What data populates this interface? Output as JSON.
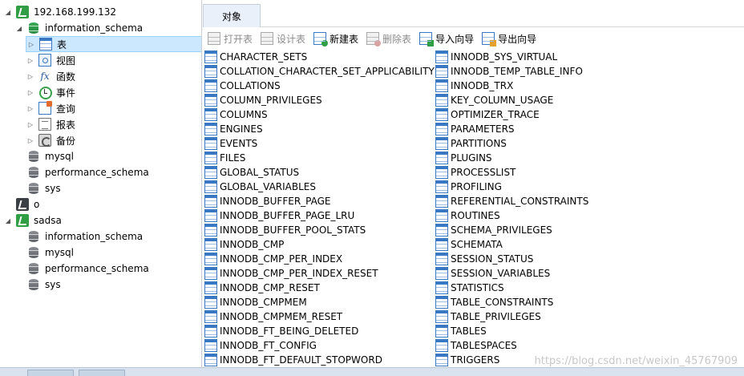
{
  "tree": {
    "connections": [
      {
        "name": "192.168.199.132",
        "icon": "mysql-connection-icon",
        "expanded": true,
        "databases": [
          {
            "name": "information_schema",
            "expanded": true,
            "children": [
              {
                "label": "表",
                "icon": "table-icon",
                "selected": true
              },
              {
                "label": "视图",
                "icon": "view-icon"
              },
              {
                "label": "函数",
                "icon": "function-icon"
              },
              {
                "label": "事件",
                "icon": "event-icon"
              },
              {
                "label": "查询",
                "icon": "query-icon"
              },
              {
                "label": "报表",
                "icon": "report-icon"
              },
              {
                "label": "备份",
                "icon": "backup-icon"
              }
            ]
          },
          {
            "name": "mysql"
          },
          {
            "name": "performance_schema"
          },
          {
            "name": "sys"
          }
        ]
      },
      {
        "name": "o",
        "icon": "mysql-connection-icon",
        "expanded": false,
        "databases": []
      },
      {
        "name": "sadsa",
        "icon": "mysql-connection-icon",
        "expanded": true,
        "databases": [
          {
            "name": "information_schema"
          },
          {
            "name": "mysql"
          },
          {
            "name": "performance_schema"
          },
          {
            "name": "sys"
          }
        ]
      }
    ]
  },
  "tabs": [
    {
      "label": "对象",
      "active": true
    }
  ],
  "toolbar": {
    "open_table": "打开表",
    "design_table": "设计表",
    "new_table": "新建表",
    "delete_table": "删除表",
    "import_wizard": "导入向导",
    "export_wizard": "导出向导"
  },
  "objects": {
    "column1": [
      "CHARACTER_SETS",
      "COLLATION_CHARACTER_SET_APPLICABILITY",
      "COLLATIONS",
      "COLUMN_PRIVILEGES",
      "COLUMNS",
      "ENGINES",
      "EVENTS",
      "FILES",
      "GLOBAL_STATUS",
      "GLOBAL_VARIABLES",
      "INNODB_BUFFER_PAGE",
      "INNODB_BUFFER_PAGE_LRU",
      "INNODB_BUFFER_POOL_STATS",
      "INNODB_CMP",
      "INNODB_CMP_PER_INDEX",
      "INNODB_CMP_PER_INDEX_RESET",
      "INNODB_CMP_RESET",
      "INNODB_CMPMEM",
      "INNODB_CMPMEM_RESET",
      "INNODB_FT_BEING_DELETED",
      "INNODB_FT_CONFIG",
      "INNODB_FT_DEFAULT_STOPWORD"
    ],
    "column2": [
      "INNODB_SYS_VIRTUAL",
      "INNODB_TEMP_TABLE_INFO",
      "INNODB_TRX",
      "KEY_COLUMN_USAGE",
      "OPTIMIZER_TRACE",
      "PARAMETERS",
      "PARTITIONS",
      "PLUGINS",
      "PROCESSLIST",
      "PROFILING",
      "REFERENTIAL_CONSTRAINTS",
      "ROUTINES",
      "SCHEMA_PRIVILEGES",
      "SCHEMATA",
      "SESSION_STATUS",
      "SESSION_VARIABLES",
      "STATISTICS",
      "TABLE_CONSTRAINTS",
      "TABLE_PRIVILEGES",
      "TABLES",
      "TABLESPACES",
      "TRIGGERS"
    ]
  },
  "watermark": "https://blog.csdn.net/weixin_45767909",
  "colors": {
    "selection": "#cce8ff",
    "connection_green": "#2f9e44",
    "table_blue": "#3a78c3"
  }
}
